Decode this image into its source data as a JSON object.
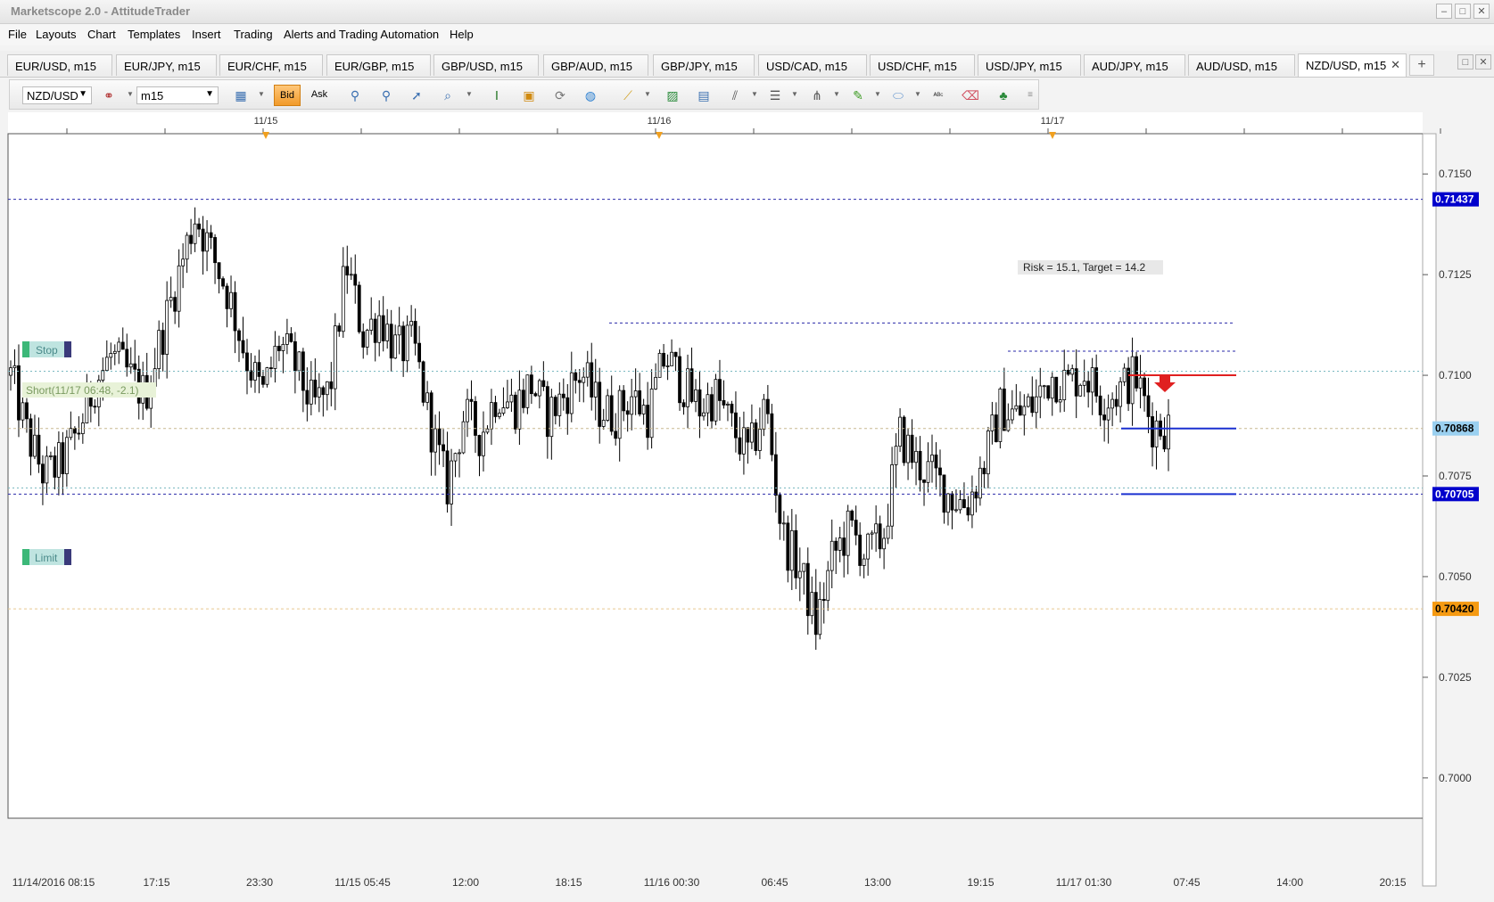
{
  "window": {
    "title": "Marketscope 2.0 - AttitudeTrader",
    "minimize": "–",
    "restore": "□",
    "close": "✕"
  },
  "menu": [
    "File",
    "Layouts",
    "Chart",
    "Templates",
    "Insert",
    "Trading",
    "Alerts and Trading Automation",
    "Help"
  ],
  "tabs": [
    {
      "label": "EUR/USD, m15",
      "active": false
    },
    {
      "label": "EUR/JPY, m15",
      "active": false
    },
    {
      "label": "EUR/CHF, m15",
      "active": false
    },
    {
      "label": "EUR/GBP, m15",
      "active": false
    },
    {
      "label": "GBP/USD, m15",
      "active": false
    },
    {
      "label": "GBP/AUD, m15",
      "active": false
    },
    {
      "label": "GBP/JPY, m15",
      "active": false
    },
    {
      "label": "USD/CAD, m15",
      "active": false
    },
    {
      "label": "USD/CHF, m15",
      "active": false
    },
    {
      "label": "USD/JPY, m15",
      "active": false
    },
    {
      "label": "AUD/JPY, m15",
      "active": false
    },
    {
      "label": "AUD/USD, m15",
      "active": false
    },
    {
      "label": "NZD/USD, m15",
      "active": true
    }
  ],
  "tab_close": "✕",
  "tab_add": "+",
  "toolbar": {
    "instrument": "NZD/USD",
    "timeframe": "m15",
    "bid_label": "Bid",
    "ask_label": "Ask",
    "icons": [
      "chart-type-icon",
      "indicator-icon",
      "crosshair-icon",
      "zoom-icon",
      "cursor-icon",
      "zoom-in-icon",
      "price-marker-icon",
      "ruler-icon",
      "refresh-icon",
      "globe-icon",
      "pencil-icon",
      "image-icon",
      "screenshot-icon",
      "fibonacci-icon",
      "levels-icon",
      "pitchfork-icon",
      "line-icon",
      "ellipse-icon",
      "text-abc-icon",
      "eraser-icon",
      "hierarchy-icon",
      "more-icon"
    ]
  },
  "chart_data": {
    "type": "candlestick",
    "instrument": "NZD/USD",
    "timeframe": "m15",
    "date_markers": [
      "11/15",
      "11/16",
      "11/17"
    ],
    "x_labels": [
      "11/14/2016 08:15",
      "17:15",
      "23:30",
      "11/15 05:45",
      "12:00",
      "18:15",
      "11/16 00:30",
      "06:45",
      "13:00",
      "19:15",
      "11/17 01:30",
      "07:45",
      "14:00",
      "20:15"
    ],
    "y_ticks": [
      "0.7150",
      "0.7125",
      "0.7100",
      "0.7075",
      "0.7050",
      "0.7025",
      "0.7000"
    ],
    "ylim": [
      0.699,
      0.716
    ],
    "price_labels": [
      {
        "value": "0.71437",
        "style": "blue"
      },
      {
        "value": "0.70868",
        "style": "lightblue"
      },
      {
        "value": "0.70705",
        "style": "blue"
      },
      {
        "value": "0.70420",
        "style": "orange"
      }
    ],
    "annotations": {
      "stop_label": "Stop",
      "limit_label": "Limit",
      "short_label": "Short(11/17 06:48, -2.1)",
      "risk_target": "Risk = 15.1, Target = 14.2"
    },
    "close_path": [
      0.71,
      0.7085,
      0.7075,
      0.7078,
      0.7086,
      0.7098,
      0.7105,
      0.71,
      0.7095,
      0.711,
      0.7125,
      0.714,
      0.713,
      0.712,
      0.7105,
      0.7095,
      0.7108,
      0.7102,
      0.7092,
      0.7096,
      0.7128,
      0.711,
      0.7115,
      0.7106,
      0.7108,
      0.7088,
      0.7072,
      0.709,
      0.7085,
      0.7096,
      0.7092,
      0.7098,
      0.709,
      0.7095,
      0.7101,
      0.7092,
      0.709,
      0.7095,
      0.709,
      0.7105,
      0.7098,
      0.7092,
      0.7095,
      0.7087,
      0.708,
      0.7093,
      0.706,
      0.7052,
      0.7038,
      0.7055,
      0.7062,
      0.7055,
      0.706,
      0.7085,
      0.7078,
      0.7075,
      0.707,
      0.7068,
      0.7078,
      0.7092,
      0.709,
      0.7093,
      0.71,
      0.7098,
      0.7101,
      0.7094,
      0.7096,
      0.71,
      0.7088,
      0.7087
    ]
  }
}
